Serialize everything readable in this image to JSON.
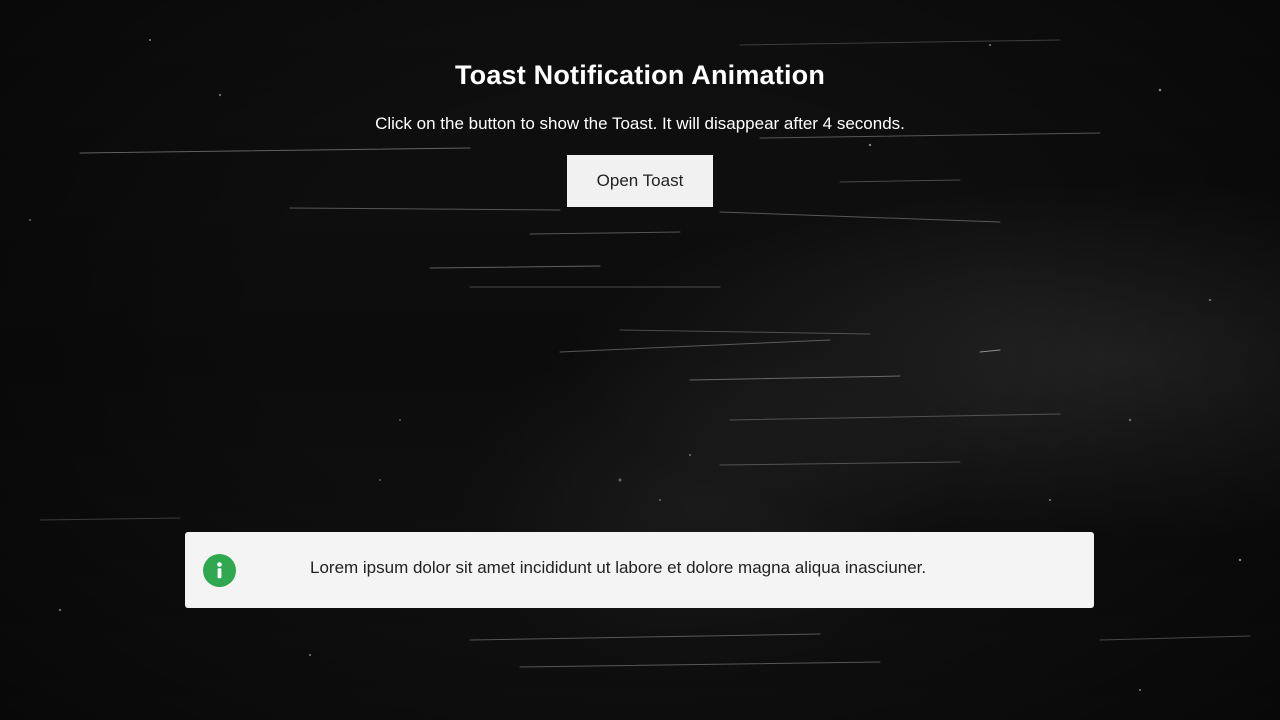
{
  "header": {
    "title": "Toast Notification Animation",
    "subtitle": "Click on the button to show the Toast. It will disappear after 4 seconds."
  },
  "button": {
    "label": "Open Toast"
  },
  "toast": {
    "icon": "info-icon",
    "message": "Lorem ipsum dolor sit amet incididunt ut labore et dolore magna aliqua inasciuner.",
    "accent_color": "#2fa84f",
    "background_color": "#f4f4f4"
  },
  "theme": {
    "page_background": "#0b0b0b",
    "text_color": "#ffffff"
  }
}
